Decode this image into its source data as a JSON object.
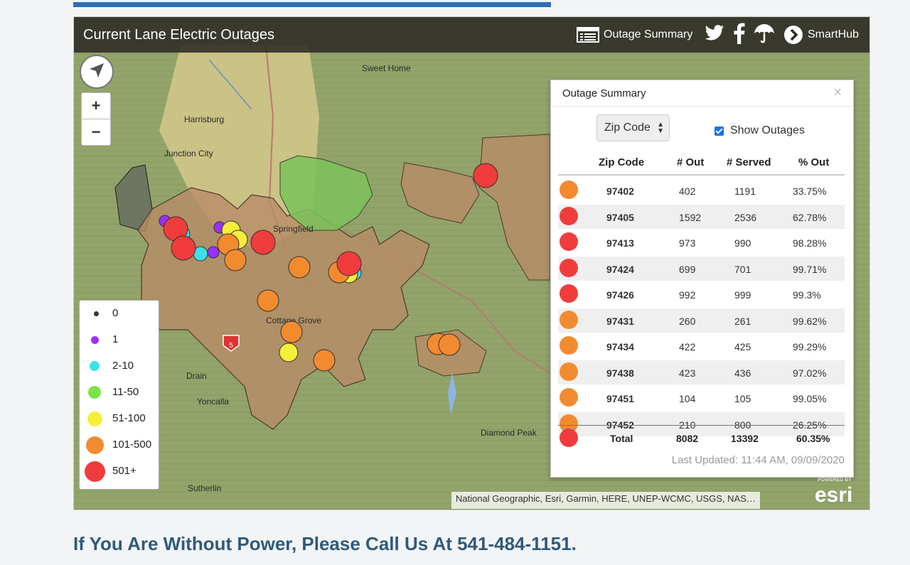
{
  "header": {
    "title": "Current Lane Electric Outages",
    "outage_summary_label": "Outage Summary",
    "smarthub_label": "SmartHub"
  },
  "map": {
    "zoom_in": "+",
    "zoom_out": "−",
    "places": [
      "Sweet Home",
      "Harrisburg",
      "Junction City",
      "Springfield",
      "Cottage Grove",
      "Drain",
      "Yoncalla",
      "Sutherlin",
      "Diamond Peak"
    ],
    "attribution": "National Geographic, Esri, Garmin, HERE, UNEP-WCMC, USGS, NAS…",
    "esri_powered": "POWERED BY",
    "esri_logo": "esri",
    "shield_number": "5"
  },
  "legend": [
    {
      "label": "0",
      "color": "#333333"
    },
    {
      "label": "1",
      "color": "#9b30ff"
    },
    {
      "label": "2-10",
      "color": "#3ee0e8"
    },
    {
      "label": "11-50",
      "color": "#7be34a"
    },
    {
      "label": "51-100",
      "color": "#f5ef3a"
    },
    {
      "label": "101-500",
      "color": "#f28b30"
    },
    {
      "label": "501+",
      "color": "#f03c3c"
    }
  ],
  "summary": {
    "title": "Outage Summary",
    "close": "×",
    "select_value": "Zip Code",
    "show_outages_label": "Show Outages",
    "columns": [
      "Zip Code",
      "# Out",
      "# Served",
      "% Out"
    ],
    "rows": [
      {
        "zip": "97402",
        "out": "402",
        "served": "1191",
        "pct": "33.75%",
        "color": "#f28b30"
      },
      {
        "zip": "97405",
        "out": "1592",
        "served": "2536",
        "pct": "62.78%",
        "color": "#f03c3c"
      },
      {
        "zip": "97413",
        "out": "973",
        "served": "990",
        "pct": "98.28%",
        "color": "#f03c3c"
      },
      {
        "zip": "97424",
        "out": "699",
        "served": "701",
        "pct": "99.71%",
        "color": "#f03c3c"
      },
      {
        "zip": "97426",
        "out": "992",
        "served": "999",
        "pct": "99.3%",
        "color": "#f03c3c"
      },
      {
        "zip": "97431",
        "out": "260",
        "served": "261",
        "pct": "99.62%",
        "color": "#f28b30"
      },
      {
        "zip": "97434",
        "out": "422",
        "served": "425",
        "pct": "99.29%",
        "color": "#f28b30"
      },
      {
        "zip": "97438",
        "out": "423",
        "served": "436",
        "pct": "97.02%",
        "color": "#f28b30"
      },
      {
        "zip": "97451",
        "out": "104",
        "served": "105",
        "pct": "99.05%",
        "color": "#f28b30"
      },
      {
        "zip": "97452",
        "out": "210",
        "served": "800",
        "pct": "26.25%",
        "color": "#f28b30"
      }
    ],
    "total": {
      "label": "Total",
      "out": "8082",
      "served": "13392",
      "pct": "60.35%",
      "color": "#f03c3c"
    },
    "last_updated": "Last Updated: 11:44 AM, 09/09/2020"
  },
  "call_to_action": "If You Are Without Power, Please Call Us At 541-484-1151."
}
